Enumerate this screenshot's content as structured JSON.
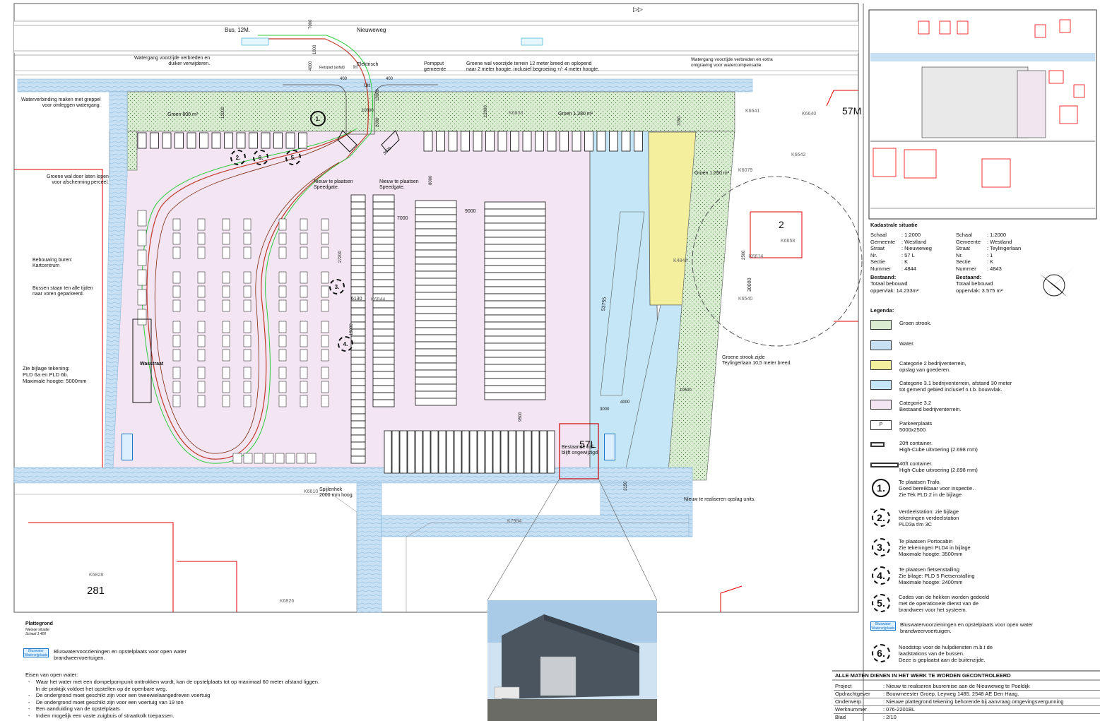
{
  "colors": {
    "green_strip": "#d9ecd2",
    "water": "#c7e0f4",
    "cat2": "#f3ef9c",
    "cat31": "#c5e6f7",
    "cat32": "#f3e6f2",
    "cadastral_red": "#e00000",
    "bus_route_red": "#c0392b",
    "bus_route_green": "#2ecc40"
  },
  "site_labels": {
    "road": "Nieuweweg",
    "bus": "Bus, 12M.",
    "watergang_left": "Watergang voorzijde verbreden en\nduiker verwijderen.",
    "waterverbinding": "Waterverbinding maken met greppel\nvoor omleggen watergang.",
    "pomput": "Pompput\ngemeente",
    "groene_wal": "Groene wal voorzijde terrein 12 meter breed en oplopend\nnaar 2 meter hoogte. inclusief begroeiing +/- 4 meter hoogte.",
    "watergang_right": "Watergang voorzijde verbreden en extra\nontgraving voor watercompensatie",
    "groene_wal_links": "Groene wal door laten lopen\nvoor afscherming perceel.",
    "speedgate1": "Nieuw te plaatsen\nSpeedgate.",
    "speedgate2": "Nieuw te plaatsen\nSpeedgate.",
    "bebouwing": "Bebouwing buren:\nKartcentrum",
    "bussen": "Bussen staan ten alle tijden\nnaar voren geparkeerd.",
    "bijlage": "Zie bijlage tekening:\nPLD 6a en PLD 6b.\nMaximale hoogte: 5000mm",
    "wasstraat": "Wasstraat",
    "groene_strook": "Groene strook zijde\nTeylingerlaan 10,5 meter breed.",
    "spijlenhek": "Spijlenhek\n2000 mm hoog.",
    "bestaande": "Bestaande hal\nblijft ongewijzigd.",
    "opslag": "Nieuw te realiseren opslag units.",
    "in": "In",
    "uit": "Uit",
    "elektrisch": "Elektrisch",
    "fietspad": "Fietspad (asfalt)",
    "groen_800": "Groen 800 m²",
    "groen_1280": "Groen 1.280 m²",
    "groen_1050": "Groen 1.050 m²",
    "lot_57L": "57L",
    "lot_57M": "57M",
    "lot_2": "2",
    "lot_281": "281",
    "dims": [
      "7000",
      "400",
      "4000",
      "400",
      "15000",
      "10000",
      "2000",
      "12000",
      "3000",
      "7000",
      "9000",
      "8000",
      "27200",
      "6130",
      "15000",
      "9500",
      "53755",
      "30000",
      "4000",
      "3000",
      "10500",
      "3150",
      "3150",
      "12000",
      "2500",
      "1000"
    ],
    "parcels": [
      "K6641",
      "K6640",
      "K6642",
      "K6079",
      "K6658",
      "K6614",
      "K6540",
      "K6844",
      "K6833",
      "K4844",
      "K6610",
      "K7994",
      "K6828",
      "K6826"
    ]
  },
  "plattegrond": {
    "title": "Plattegrond",
    "sub1": "Nieuwe situatie",
    "sub2": "Schaal 1:400"
  },
  "bluswater_bottom": "Bluswatervoorzieningen en opstelplaats voor open water\nbrandweervoertuigen.",
  "eisen": {
    "title": "Eisen van open water:",
    "items": [
      "Waar het water met een dompelpompunit onttrokken wordt, kan de opstelplaats tot op maximaal 60 meter afstand liggen.",
      "In de praktijk voldoet het opstellen op de openbare weg.",
      "De ondergrond moet geschikt zijn voor een tweewielaangedreven   voertuig",
      "De ondergrond moet geschikt zijn voor een voertuig van 19 ton",
      "Een aanduiding van de opstelplaats",
      "Indien mogelijk een vaste zuigbuis of straatkolk toepassen."
    ]
  },
  "kadastrale": {
    "title": "Kadastrale situatie",
    "left": [
      [
        "Schaal",
        ": 1:2000"
      ],
      [
        "Gemeente",
        ": Westland"
      ],
      [
        "Straat",
        ": Nieuweweg"
      ],
      [
        "Nr.",
        ": 57 L"
      ],
      [
        "Sectie",
        ": K"
      ],
      [
        "Nummer",
        ": 4844"
      ]
    ],
    "right": [
      [
        "Schaal",
        ": 1:2000"
      ],
      [
        "Gemeente",
        ": Westland"
      ],
      [
        "Straat",
        ": Teylingerlaan"
      ],
      [
        "Nr.",
        ": 1"
      ],
      [
        "Sectie",
        ": K"
      ],
      [
        "Nummer",
        ": 4843"
      ]
    ],
    "left_bestaand": "Bestaand:",
    "left_totaal": "Totaal bebouwd\noppervlak: 14.233m²",
    "right_bestaand": "Bestaand:",
    "right_totaal": "Totaal bebouwd\noppervlak: 3.575 m²"
  },
  "legend": {
    "title": "Legenda:",
    "items": [
      "Groen strook.",
      "Water.",
      "Categorie 2 bedrijventerrein,\nopslag van goederen.",
      "Categorie 3.1 bedrijventerrein, afstand 30 meter\ntot gemend gebied inclusief n.t.b. bouwvlak.",
      "Categorie 3.2\nBestaand bedrijventerrein.",
      "Parkeerplaats\n5000x2500",
      "20ft container.\nHigh-Cube uitvoering (2.698 mm)",
      "40ft container.\nHigh-Cube uitvoering (2.698 mm)"
    ],
    "numbered": [
      {
        "n": "1.",
        "text": "Te plaatsen Trafo,\nGoed bereikbaar voor inspectie.\nZie Tek PLD.2 in de bijlage"
      },
      {
        "n": "2.",
        "text": "Verdeelstation: zie bijlage\ntekeningen verdeelstation\nPLD3a t/m 3C"
      },
      {
        "n": "3.",
        "text": "Te plaatsen Portocabin\nZie tekeningen PLD4 in bijlage\nMaximale hoogte: 3500mm"
      },
      {
        "n": "4.",
        "text": "Te plaatsen fietsenstalling\nZie bilage: PLD 5 Fietsenstalling\nMaximale hoogte: 2400mm"
      },
      {
        "n": "5.",
        "text": "Codes van de hekken worden gedeeld\nmet de operationele dienst van de\nbrandweer voor het systeem."
      },
      {
        "n": "6.",
        "text": "Noodstop voor de hulpdiensten m.b.t de\nlaadstations van de bussen.\nDeze is geplaatst aan de buitenzijde."
      }
    ],
    "bluswater": "Bluswatervoorzieningen en opstelplaats voor open water\nbrandweervoertuigen.",
    "p_symbol": "P"
  },
  "info": {
    "heading": "ALLE MATEN DIENEN IN HET WERK TE WORDEN GECONTROLEERD",
    "rows": [
      [
        "Project",
        ": Nieuw te realiseren busremise aan de Nieuweweg te Poeldijk"
      ],
      [
        "Opdrachtgever",
        ": Bouwmeester Groep, Leyweg 1485. 2548 AE Den Haag."
      ],
      [
        "Onderwerp",
        ": Nieuwe plattegrond tekening behorende bij aanvraag omgevingsvergunning"
      ],
      [
        "Werknummer",
        ": 076-2201BL"
      ],
      [
        "Blad",
        ": 2/10"
      ]
    ]
  },
  "badge": "Bluswater\nWatervrijplaats"
}
